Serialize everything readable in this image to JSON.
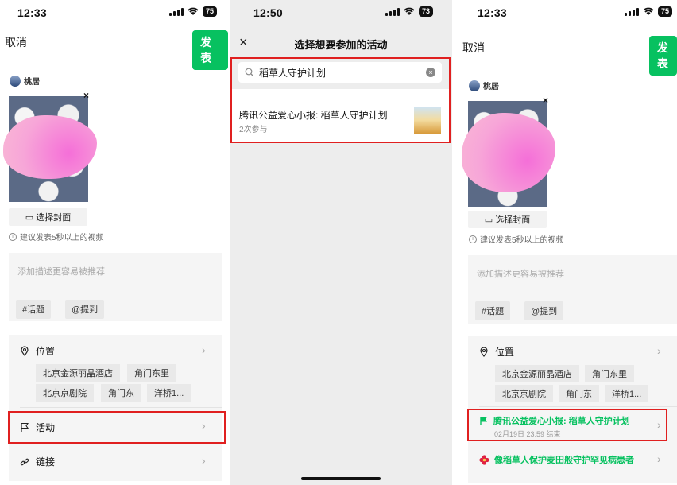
{
  "status_bars": [
    {
      "time": "12:33",
      "battery": "75"
    },
    {
      "time": "12:50",
      "battery": "73"
    },
    {
      "time": "12:33",
      "battery": "75"
    }
  ],
  "compose": {
    "cancel": "取消",
    "publish": "发表",
    "username": "桃居",
    "thumb_close": "×",
    "cover_button": "选择封面",
    "hint": "建议发表5秒以上的视频",
    "desc_placeholder": "添加描述更容易被推荐",
    "topic_chip": "#话题",
    "mention_chip": "@提到",
    "location_label": "位置",
    "location_chips": [
      "北京金源丽晶酒店",
      "角门东里",
      "北京京剧院",
      "角门东",
      "洋桥1..."
    ],
    "activity_label": "活动",
    "link_label": "链接",
    "chevron": "›",
    "selected_activity": "腾讯公益爱心小报: 稻草人守护计划",
    "selected_activity_time": "02月19日 23:59 结束",
    "suggested_activity": "像稻草人保护麦田般守护罕见病患者"
  },
  "picker": {
    "close": "×",
    "title": "选择想要参加的活动",
    "search_value": "稻草人守护计划",
    "clear": "×",
    "result_title": "腾讯公益爱心小报: 稻草人守护计划",
    "result_sub": "2次参与"
  },
  "colors": {
    "brand_green": "#07c160",
    "highlight_red": "#e02020"
  }
}
